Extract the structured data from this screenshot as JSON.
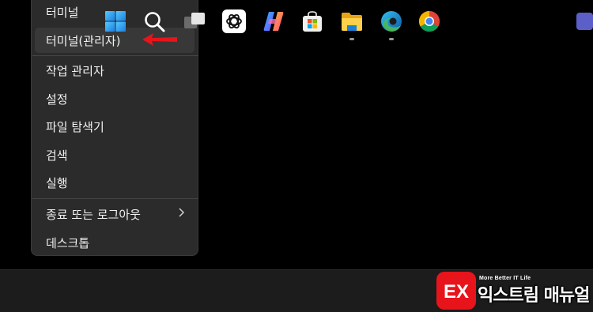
{
  "menu": {
    "items": [
      {
        "label": "터미널"
      },
      {
        "label": "터미널(관리자)"
      },
      {
        "label": "작업 관리자"
      },
      {
        "label": "설정"
      },
      {
        "label": "파일 탐색기"
      },
      {
        "label": "검색"
      },
      {
        "label": "실행"
      },
      {
        "label": "종료 또는 로그아웃",
        "submenu_icon": "chevron-right-icon"
      },
      {
        "label": "데스크톱"
      }
    ],
    "highlighted": "터미널(관리자)",
    "annotation": {
      "icon": "red-arrow-icon",
      "color": "#e8141b"
    }
  },
  "taskbar": {
    "icons": [
      "windows-start-icon",
      "search-icon",
      "task-view-icon",
      "chatgpt-icon",
      "copilot-icon",
      "microsoft-store-icon",
      "file-explorer-icon",
      "edge-icon",
      "chrome-icon"
    ],
    "running": [
      "file-explorer-icon",
      "edge-icon"
    ]
  },
  "watermark": {
    "logo": "EX",
    "tagline": "More Better IT Life",
    "title": "익스트림 매뉴얼",
    "color": "#e8141b"
  }
}
